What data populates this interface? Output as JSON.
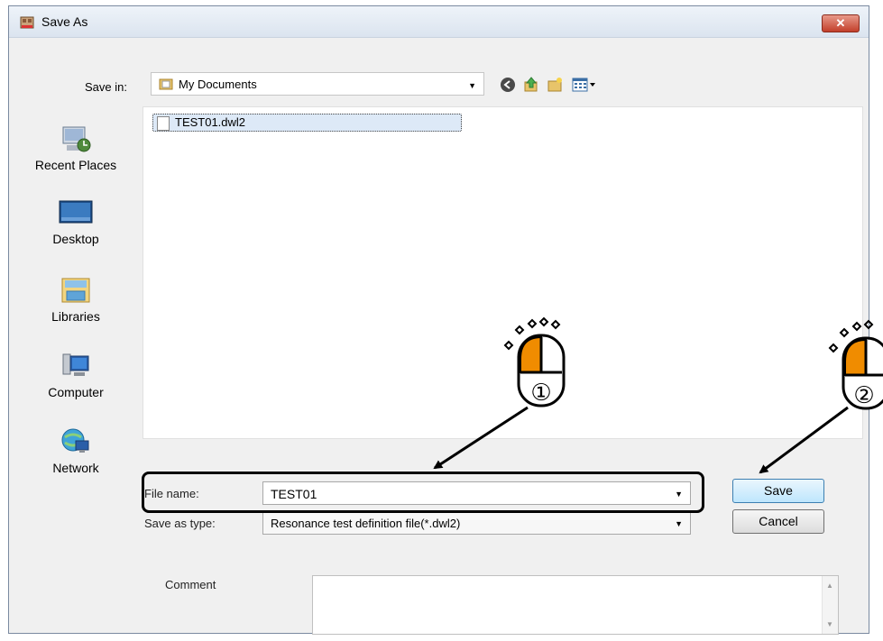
{
  "window": {
    "title": "Save As",
    "close_glyph": "✕"
  },
  "save_in": {
    "label": "Save in:",
    "value": "My Documents"
  },
  "places": [
    {
      "label": "Recent Places",
      "icon": "recent-places-icon"
    },
    {
      "label": "Desktop",
      "icon": "desktop-icon"
    },
    {
      "label": "Libraries",
      "icon": "libraries-icon"
    },
    {
      "label": "Computer",
      "icon": "computer-icon"
    },
    {
      "label": "Network",
      "icon": "network-icon"
    }
  ],
  "files": [
    {
      "name": "TEST01.dwl2"
    }
  ],
  "file_name": {
    "label": "File name:",
    "value": "TEST01"
  },
  "save_as_type": {
    "label": "Save as type:",
    "value": "Resonance test definition file(*.dwl2)"
  },
  "buttons": {
    "save": "Save",
    "cancel": "Cancel"
  },
  "comment": {
    "label": "Comment",
    "value": ""
  },
  "annotations": {
    "step1": "①",
    "step2": "②"
  },
  "colors": {
    "accent": "#f08c00",
    "button_default": "#bee6fd",
    "selection": "#dde9f7"
  }
}
